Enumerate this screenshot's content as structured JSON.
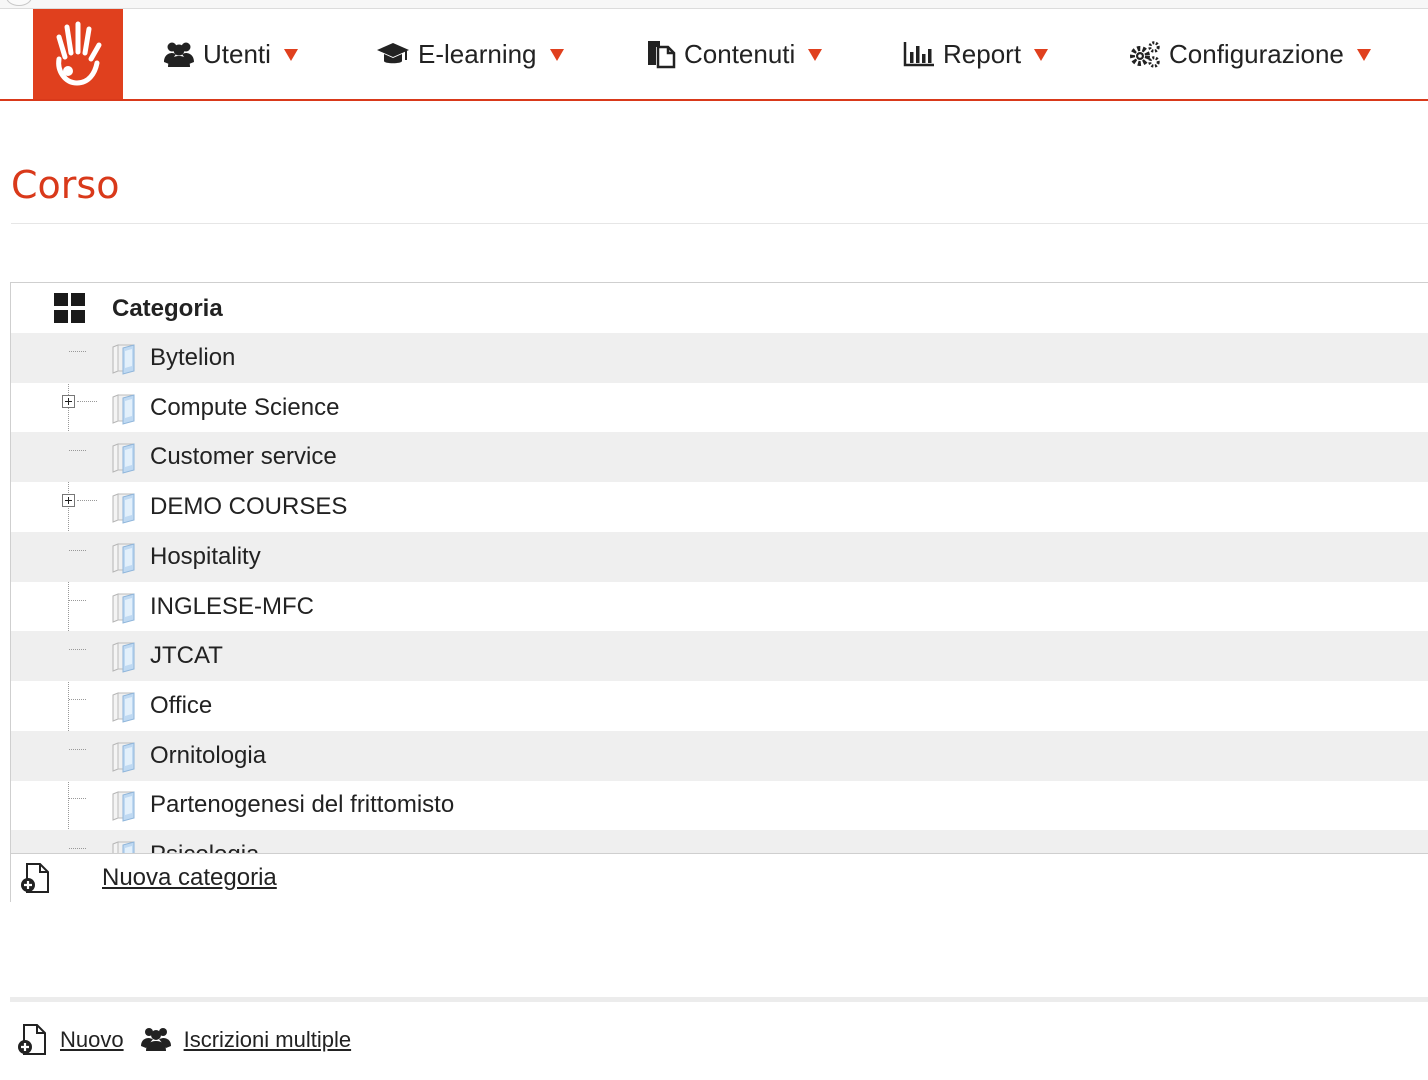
{
  "nav": {
    "items": [
      {
        "label": "Utenti",
        "icon": "users-icon"
      },
      {
        "label": "E-learning",
        "icon": "graduation-cap-icon"
      },
      {
        "label": "Contenuti",
        "icon": "documents-icon"
      },
      {
        "label": "Report",
        "icon": "bar-chart-icon"
      },
      {
        "label": "Configurazione",
        "icon": "gears-icon"
      }
    ],
    "accent_color": "#e0401e"
  },
  "page": {
    "title": "Corso"
  },
  "tree": {
    "header_label": "Categoria",
    "rows": [
      {
        "label": "Bytelion",
        "expandable": false
      },
      {
        "label": "Compute Science",
        "expandable": true
      },
      {
        "label": "Customer service",
        "expandable": false
      },
      {
        "label": "DEMO COURSES",
        "expandable": true
      },
      {
        "label": "Hospitality",
        "expandable": false
      },
      {
        "label": "INGLESE-MFC",
        "expandable": false
      },
      {
        "label": "JTCAT",
        "expandable": false
      },
      {
        "label": "Office",
        "expandable": false
      },
      {
        "label": "Ornitologia",
        "expandable": false
      },
      {
        "label": "Partenogenesi del frittomisto",
        "expandable": false
      },
      {
        "label": "Psicologia",
        "expandable": false
      }
    ],
    "footer_link": "Nuova categoria"
  },
  "actions": {
    "new_label": "Nuovo",
    "multi_enroll_label": "Iscrizioni multiple"
  }
}
